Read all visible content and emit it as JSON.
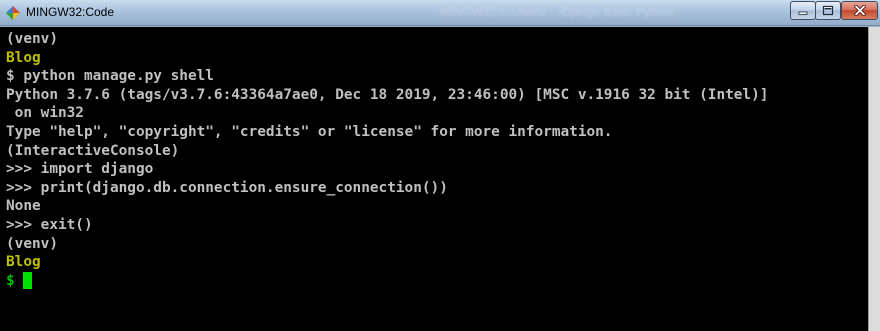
{
  "window": {
    "title": "MINGW32:Code",
    "faded_title": "MINGW32:/c/Users/…/Django Basic Python",
    "controls": {
      "minimize": "–",
      "maximize": "□",
      "close": "✕"
    },
    "icon": "mingw-diamond-icon"
  },
  "terminal": {
    "lines": [
      {
        "text": "(venv)",
        "color": "#c0c0c0"
      },
      {
        "text": "Blog",
        "color": "#bfbf00"
      },
      {
        "text": "$ python manage.py shell",
        "color": "#c0c0c0"
      },
      {
        "text": "Python 3.7.6 (tags/v3.7.6:43364a7ae0, Dec 18 2019, 23:46:00) [MSC v.1916 32 bit (Intel)]",
        "color": "#c0c0c0"
      },
      {
        "text": " on win32",
        "color": "#c0c0c0"
      },
      {
        "text": "Type \"help\", \"copyright\", \"credits\" or \"license\" for more information.",
        "color": "#c0c0c0"
      },
      {
        "text": "(InteractiveConsole)",
        "color": "#c0c0c0"
      },
      {
        "text": ">>> import django",
        "color": "#c0c0c0"
      },
      {
        "text": ">>> print(django.db.connection.ensure_connection())",
        "color": "#c0c0c0"
      },
      {
        "text": "None",
        "color": "#c0c0c0"
      },
      {
        "text": ">>> exit()",
        "color": "#c0c0c0"
      },
      {
        "text": "(venv)",
        "color": "#c0c0c0"
      },
      {
        "text": "Blog",
        "color": "#bfbf00"
      }
    ],
    "prompt": "$",
    "prompt_color": "#00c000"
  }
}
